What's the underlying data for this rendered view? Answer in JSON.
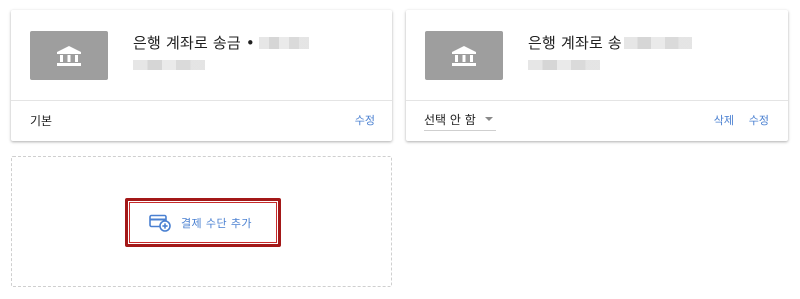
{
  "payment_methods": [
    {
      "title": "은행 계좌로 송금 •",
      "status_label": "기본",
      "actions": {
        "edit_label": "수정"
      }
    },
    {
      "title": "은행 계좌로 송",
      "select": {
        "value": "선택 안 함"
      },
      "actions": {
        "delete_label": "삭제",
        "edit_label": "수정"
      }
    }
  ],
  "add_payment": {
    "label": "결제 수단 추가",
    "icon": "add-card-icon"
  },
  "icons": {
    "bank": "bank-icon",
    "dropdown": "caret-down-icon"
  },
  "colors": {
    "accent": "#4a80d1",
    "highlight_border": "#a31818",
    "tile": "#9e9e9e"
  }
}
